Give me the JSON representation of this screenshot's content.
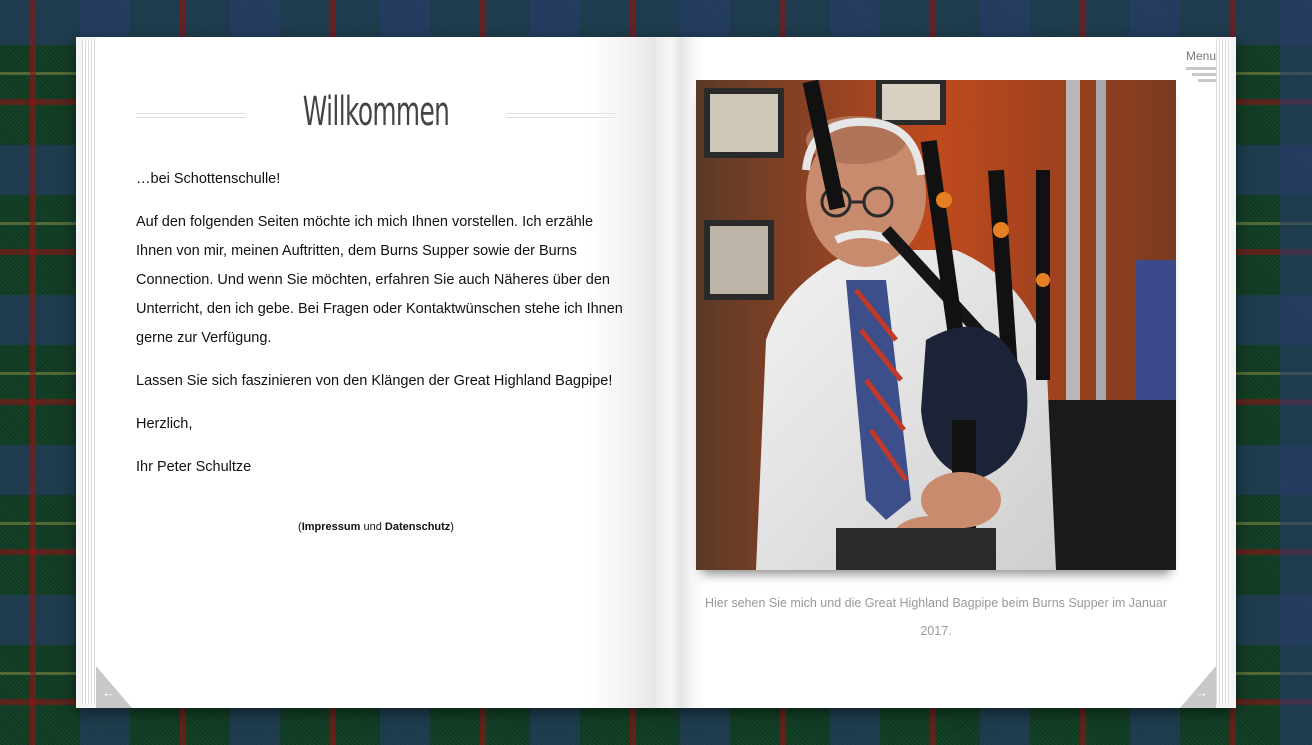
{
  "left_page": {
    "title": "Willkommen",
    "paragraphs": [
      "…bei Schottenschulle!",
      "Auf den folgenden Seiten möchte ich mich Ihnen vorstellen. Ich erzähle Ihnen von mir, meinen Auftritten, dem Burns Supper sowie der Burns Connection. Und wenn Sie möchten, erfahren Sie auch Näheres über den Unterricht, den ich gebe. Bei Fragen oder Kontaktwünschen stehe ich Ihnen gerne zur Verfügung.",
      "Lassen Sie sich faszinieren von den Klängen der Great Highland Bagpipe!",
      "Herzlich,",
      "Ihr Peter Schultze"
    ],
    "legal": {
      "open": "(",
      "impressum": "Impressum",
      "and": "und",
      "datenschutz": "Datenschutz",
      "close": ")"
    },
    "prev_arrow": "←"
  },
  "right_page": {
    "menu_label": "Menu",
    "caption": "Hier sehen Sie mich und die Great Highland Bagpipe beim Burns Supper im Januar 2017.",
    "next_arrow": "→"
  },
  "colors": {
    "page_bg": "#ffffff",
    "title_color": "#444444",
    "caption_color": "#999999",
    "corner_color": "#c8c8c8"
  }
}
